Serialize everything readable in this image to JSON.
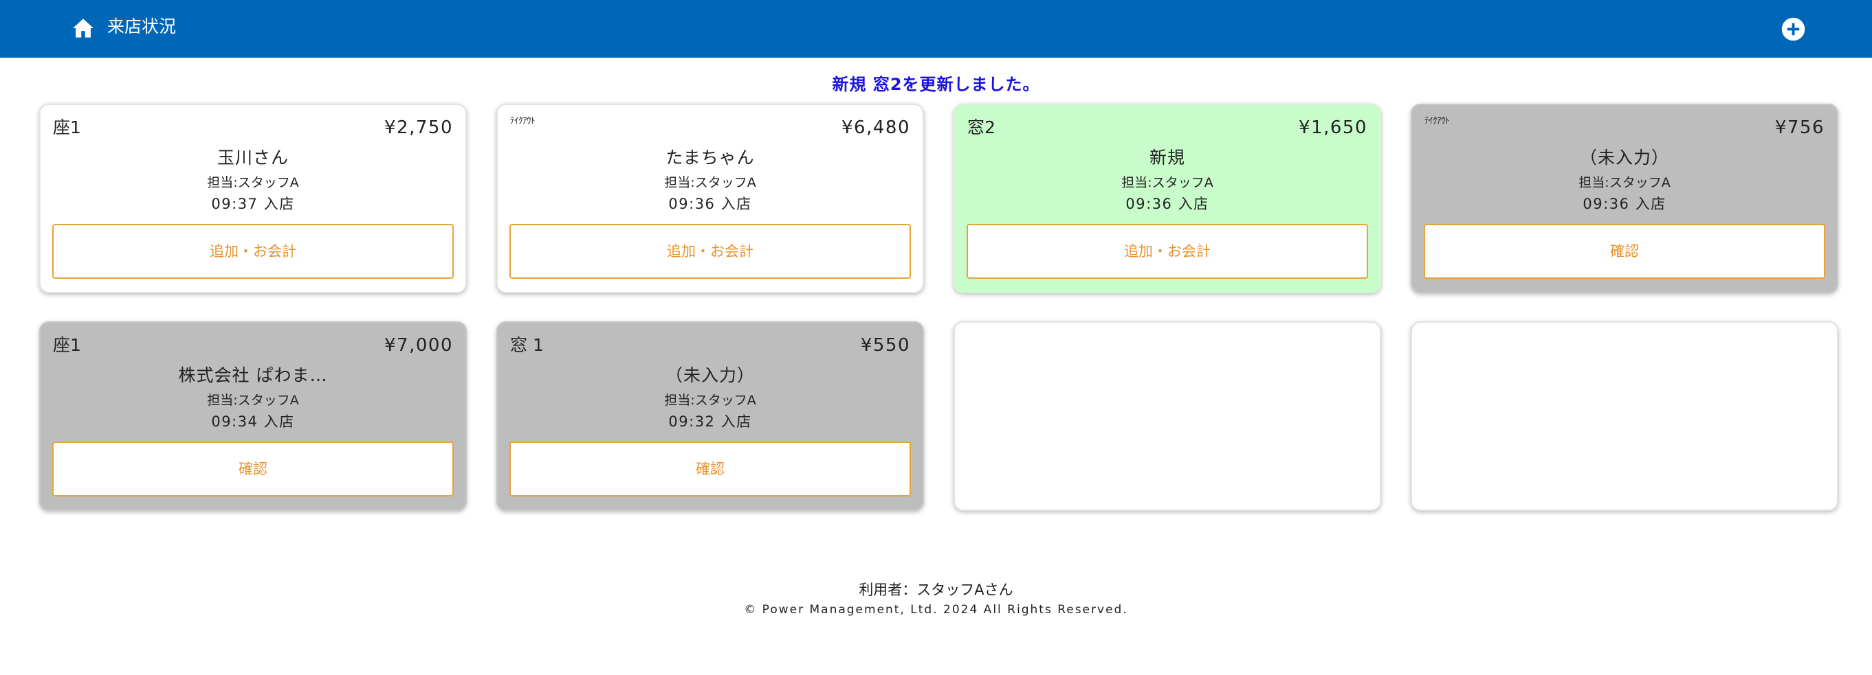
{
  "header": {
    "title": "来店状況",
    "home_icon": "home-icon",
    "add_icon": "plus-circle-icon"
  },
  "notice": "新規 窓2を更新しました。",
  "cards": [
    {
      "seat": "座1",
      "price": "¥2,750",
      "name": "玉川さん",
      "staff": "担当:スタッフA",
      "time": "09:37 入店",
      "button": "追加・お会計",
      "state": "white"
    },
    {
      "seat": "ﾃｲｸｱｳﾄ",
      "price": "¥6,480",
      "name": "たまちゃん",
      "staff": "担当:スタッフA",
      "time": "09:36 入店",
      "button": "追加・お会計",
      "state": "white"
    },
    {
      "seat": "窓2",
      "price": "¥1,650",
      "name": "新規",
      "staff": "担当:スタッフA",
      "time": "09:36 入店",
      "button": "追加・お会計",
      "state": "green"
    },
    {
      "seat": "ﾃｲｸｱｳﾄ",
      "price": "¥756",
      "name": "（未入力）",
      "staff": "担当:スタッフA",
      "time": "09:36 入店",
      "button": "確認",
      "state": "gray"
    },
    {
      "seat": "座1",
      "price": "¥7,000",
      "name": "株式会社 ぱわま…",
      "staff": "担当:スタッフA",
      "time": "09:34 入店",
      "button": "確認",
      "state": "gray"
    },
    {
      "seat": "窓 1",
      "price": "¥550",
      "name": "（未入力）",
      "staff": "担当:スタッフA",
      "time": "09:32 入店",
      "button": "確認",
      "state": "gray"
    }
  ],
  "footer": {
    "user": "利用者：スタッフAさん",
    "copyright": "© Power Management, Ltd. 2024 All Rights Reserved."
  },
  "colors": {
    "header_bg": "#0066b8",
    "notice": "#1a12e0",
    "card_active": "#c8fdcb",
    "card_inactive": "#bdbdbd",
    "button_accent": "#e8922a"
  }
}
